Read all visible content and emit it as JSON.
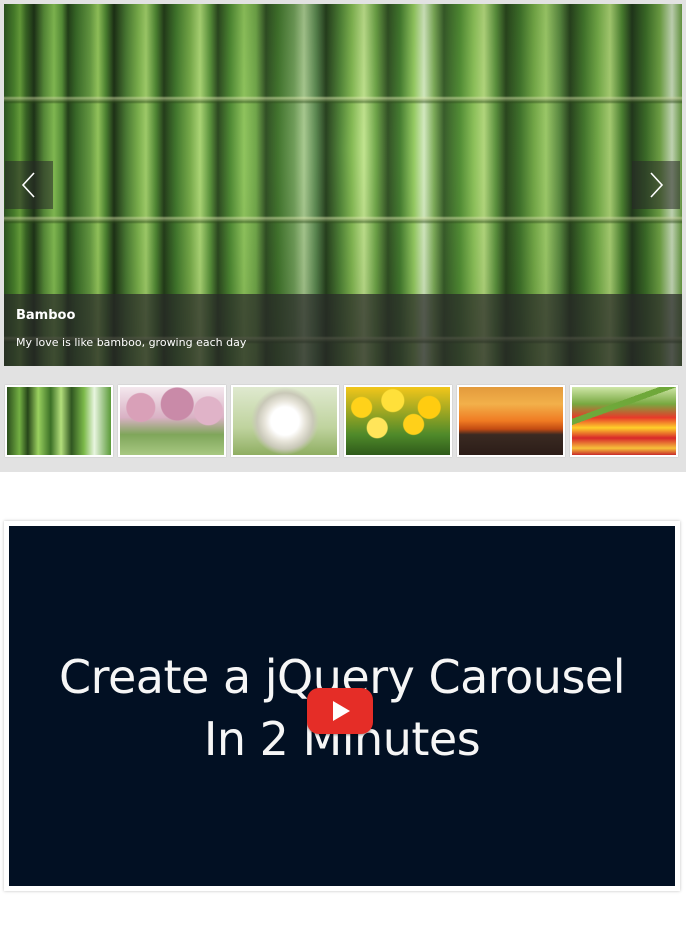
{
  "carousel": {
    "slide": {
      "title": "Bamboo",
      "caption": "My love is like bamboo, growing each day",
      "image": "bamboo"
    },
    "controls": {
      "prev_icon": "chevron-left-icon",
      "next_icon": "chevron-right-icon"
    },
    "thumbnails": [
      {
        "name": "bamboo"
      },
      {
        "name": "cherry-blossom-trees"
      },
      {
        "name": "dandelion"
      },
      {
        "name": "daffodils"
      },
      {
        "name": "sunset"
      },
      {
        "name": "tulip-field"
      }
    ],
    "active_thumbnail": 0
  },
  "video": {
    "title_line1": "Create a jQuery Carousel",
    "title_line2": "In 2 Minutes",
    "play_icon": "play-icon",
    "brand_color": "#e52d27",
    "background_color": "#021023"
  }
}
